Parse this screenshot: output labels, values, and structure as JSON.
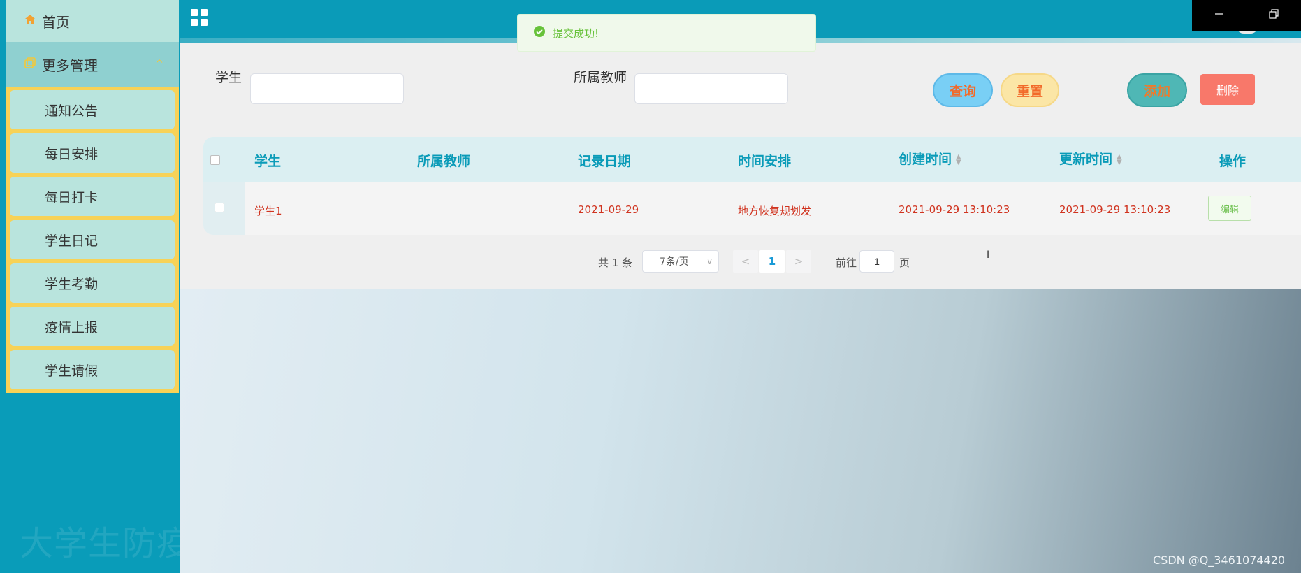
{
  "sidebar": {
    "home_label": "首页",
    "more_label": "更多管理",
    "items": [
      "通知公告",
      "每日安排",
      "每日打卡",
      "学生日记",
      "学生考勤",
      "疫情上报",
      "学生请假"
    ]
  },
  "watermark": "大学生防疫封校管理系统 演示录像",
  "toast": {
    "message": "提交成功!"
  },
  "search": {
    "student_label": "学生",
    "student_value": "",
    "teacher_label": "所属教师",
    "teacher_value": ""
  },
  "actions": {
    "query": "查询",
    "reset": "重置",
    "add": "添加",
    "delete": "删除"
  },
  "table": {
    "headers": [
      "学生",
      "所属教师",
      "记录日期",
      "时间安排",
      "创建时间",
      "更新时间",
      "操作"
    ],
    "rows": [
      {
        "student": "学生1",
        "teacher": "",
        "date": "2021-09-29",
        "schedule": "地方恢复规划发",
        "created": "2021-09-29 13:10:23",
        "updated": "2021-09-29 13:10:23",
        "edit": "编辑"
      }
    ]
  },
  "pagination": {
    "total_text": "共 1 条",
    "page_size": "7条/页",
    "current_page": "1",
    "goto_prefix": "前往",
    "goto_value": "1",
    "goto_suffix": "页"
  },
  "credit": "CSDN @Q_3461074420",
  "colors": {
    "primary": "#0a9bb8",
    "sidebar_item": "#b9e4dd",
    "submenu_bg": "#f7d257",
    "row_text": "#d0331f",
    "success": "#67c23a"
  }
}
